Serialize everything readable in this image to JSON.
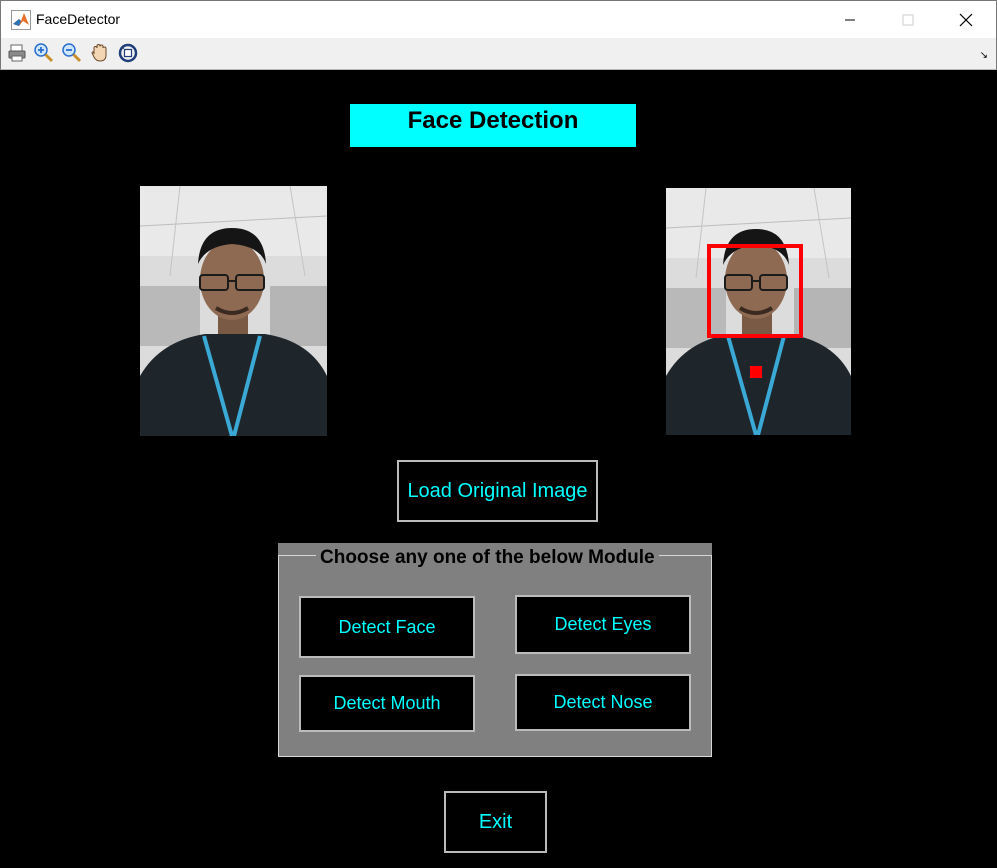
{
  "window": {
    "title": "FaceDetector"
  },
  "toolbar": {
    "tools": [
      "print-icon",
      "zoom-in-icon",
      "zoom-out-icon",
      "pan-hand-icon",
      "rotate-3d-icon"
    ]
  },
  "heading": "Face Detection",
  "buttons": {
    "load": "Load Original Image",
    "exit": "Exit"
  },
  "panel": {
    "title": "Choose any one of the below Module",
    "modules": {
      "face": "Detect Face",
      "eyes": "Detect Eyes",
      "mouth": "Detect Mouth",
      "nose": "Detect Nose"
    }
  },
  "colors": {
    "background": "#000000",
    "heading_bg": "#00ffff",
    "button_text": "#00ffff",
    "panel_bg": "#808080",
    "detection_box": "#ff0000"
  }
}
